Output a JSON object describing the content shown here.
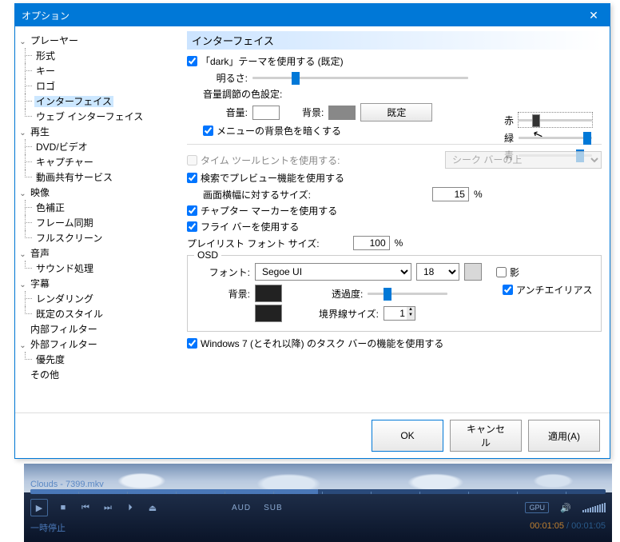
{
  "window": {
    "title": "オプション"
  },
  "tree": {
    "player": {
      "label": "プレーヤー",
      "format": "形式",
      "key": "キー",
      "logo": "ロゴ",
      "interface": "インターフェイス",
      "webif": "ウェブ インターフェイス"
    },
    "playback": {
      "label": "再生",
      "dvd": "DVD/ビデオ",
      "capture": "キャプチャー",
      "share": "動画共有サービス"
    },
    "video": {
      "label": "映像",
      "colorcorr": "色補正",
      "framesync": "フレーム同期",
      "fullscreen": "フルスクリーン"
    },
    "audio": {
      "label": "音声",
      "sound": "サウンド処理"
    },
    "subtitle": {
      "label": "字幕",
      "rendering": "レンダリング",
      "defstyle": "既定のスタイル"
    },
    "intfilter": {
      "label": "内部フィルター"
    },
    "extfilter": {
      "label": "外部フィルター",
      "priority": "優先度"
    },
    "other": {
      "label": "その他"
    }
  },
  "section": {
    "title": "インターフェイス"
  },
  "theme": {
    "use_dark": "「dark」テーマを使用する (既定)",
    "brightness_label": "明るさ:",
    "vol_color_label": "音量調節の色設定:",
    "volume_label": "音量:",
    "background_label": "背景:",
    "default_btn": "既定",
    "darken_menu": "メニューの背景色を暗くする",
    "red": "赤",
    "green": "緑",
    "blue": "青"
  },
  "timetool": {
    "label": "タイム ツールヒントを使用する:",
    "combo": "シーク バーの上"
  },
  "preview": {
    "use": "検索でプレビュー機能を使用する",
    "size_label": "画面横幅に対するサイズ:",
    "size_value": "15",
    "size_unit": "%"
  },
  "chapter": {
    "use": "チャプター マーカーを使用する"
  },
  "flybar": {
    "use": "フライ バーを使用する"
  },
  "playlist": {
    "font_label": "プレイリスト フォント サイズ:",
    "value": "100",
    "unit": "%"
  },
  "osd": {
    "legend": "OSD",
    "font_label": "フォント:",
    "font_name": "Segoe UI",
    "font_size": "18",
    "shadow": "影",
    "antialias": "アンチエイリアス",
    "bg_label": "背景:",
    "trans_label": "透過度:",
    "border_label": "境界線サイズ:",
    "border_value": "1"
  },
  "win7": {
    "label": "Windows 7 (とそれ以降) のタスク バーの機能を使用する"
  },
  "buttons": {
    "ok": "OK",
    "cancel": "キャンセル",
    "apply": "適用(A)"
  },
  "player": {
    "file": "Clouds - 7399.mkv",
    "aud": "AUD",
    "sub": "SUB",
    "gpu": "GPU",
    "status": "一時停止",
    "time_current": "00:01:05",
    "time_total": "00:01:05",
    "sep": " / "
  }
}
